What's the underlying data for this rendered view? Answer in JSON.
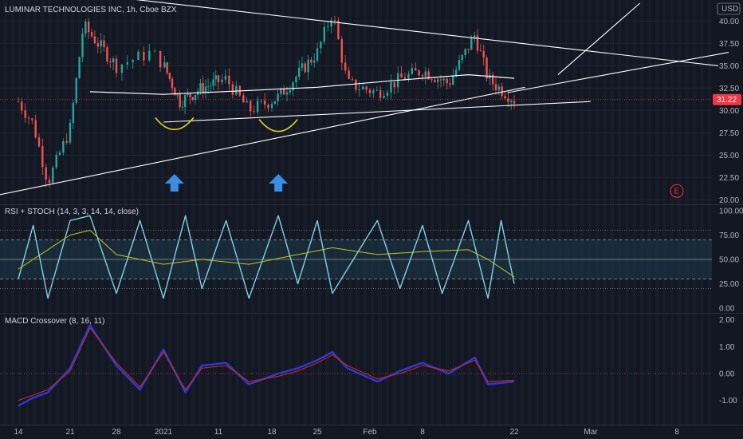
{
  "header": {
    "symbol_title": "LUMINAR TECHNOLOGIES INC, 1h, Cboe BZX",
    "currency": "USD"
  },
  "colors": {
    "background": "#131722",
    "candle_up": "#26a69a",
    "candle_down": "#ef5350",
    "trend_lines": "#ffffff",
    "rsi_line": "#7fd3e6",
    "stoch_line": "#c8c41e",
    "macd_line": "#2b3bd8",
    "signal_line": "#d0271f",
    "arrow": "#3a8ee6",
    "smile": "#e6d22a",
    "price_badge": "#f23645",
    "earnings_marker": "#f23645"
  },
  "chart_data": [
    {
      "type": "candlestick",
      "title": "LUMINAR TECHNOLOGIES INC, 1h, Cboe BZX",
      "ylim": [
        19.5,
        42
      ],
      "y_ticks": [
        "40.00",
        "37.50",
        "35.00",
        "32.50",
        "30.00",
        "27.50",
        "25.00",
        "22.50",
        "20.00"
      ],
      "last_price": "31.22",
      "approx_close_path": [
        {
          "x": "Dec 14",
          "y": 31.0
        },
        {
          "x": "Dec 16",
          "y": 28.5
        },
        {
          "x": "Dec 18",
          "y": 22.0
        },
        {
          "x": "Dec 21",
          "y": 28.0
        },
        {
          "x": "Dec 23",
          "y": 39.5
        },
        {
          "x": "Dec 28",
          "y": 35.0
        },
        {
          "x": "Dec 31",
          "y": 36.5
        },
        {
          "x": "Jan 4",
          "y": 31.0
        },
        {
          "x": "Jan 8",
          "y": 32.5
        },
        {
          "x": "Jan 12",
          "y": 33.5
        },
        {
          "x": "Jan 15",
          "y": 30.0
        },
        {
          "x": "Jan 19",
          "y": 31.5
        },
        {
          "x": "Jan 25",
          "y": 36.5
        },
        {
          "x": "Jan 27",
          "y": 41.0
        },
        {
          "x": "Jan 29",
          "y": 33.0
        },
        {
          "x": "Feb 2",
          "y": 32.0
        },
        {
          "x": "Feb 5",
          "y": 33.5
        },
        {
          "x": "Feb 8",
          "y": 34.5
        },
        {
          "x": "Feb 12",
          "y": 33.0
        },
        {
          "x": "Feb 16",
          "y": 38.5
        },
        {
          "x": "Feb 18",
          "y": 33.5
        },
        {
          "x": "Feb 22",
          "y": 31.2
        }
      ],
      "annotations": {
        "moving_average": [
          {
            "x": "Dec 24",
            "y": 32.1
          },
          {
            "x": "Jan 1",
            "y": 31.8
          },
          {
            "x": "Jan 14",
            "y": 32.2
          },
          {
            "x": "Jan 25",
            "y": 32.6
          },
          {
            "x": "Feb 5",
            "y": 33.4
          },
          {
            "x": "Feb 15",
            "y": 34.0
          },
          {
            "x": "Feb 22",
            "y": 33.6
          }
        ],
        "trend_lines": [
          {
            "from": {
              "x": "Dec 11",
              "y": 20.5
            },
            "to": {
              "x": "Feb 23",
              "y": 32.6
            }
          },
          {
            "from": {
              "x": "Jan 1",
              "y": 28.7
            },
            "to": {
              "x": "Mar 1",
              "y": 31.0
            }
          },
          {
            "from": {
              "x": "Dec 29",
              "y": 42.5
            },
            "to": {
              "x": "Mar 12",
              "y": 35.0
            }
          },
          {
            "from": {
              "x": "Feb 21",
              "y": 32.0
            },
            "to": {
              "x": "Mar 13",
              "y": 36.5
            }
          },
          {
            "from": {
              "x": "Feb 26",
              "y": 34.0
            },
            "to": {
              "x": "Mar 5",
              "y": 42.0
            }
          }
        ],
        "earnings_marker": {
          "x": "Mar 8",
          "y": 21.0,
          "label": "E"
        },
        "up_arrows": [
          "Jan 3",
          "Jan 19"
        ]
      }
    },
    {
      "type": "line",
      "title": "RSI + STOCH (14, 3, 3, 14, 14, close)",
      "ylim": [
        -5,
        105
      ],
      "y_ticks": [
        "100.00",
        "75.00",
        "50.00",
        "25.00",
        "0.00"
      ],
      "bands": {
        "upper": 70,
        "middle": 50,
        "lower": 30,
        "outer_upper": 80,
        "outer_lower": 20
      },
      "series": [
        {
          "name": "",
          "approx_values": [
            {
              "x": "Dec 14",
              "y": 30
            },
            {
              "x": "Dec 16",
              "y": 85
            },
            {
              "x": "Dec 18",
              "y": 10
            },
            {
              "x": "Dec 21",
              "y": 90
            },
            {
              "x": "Dec 24",
              "y": 95
            },
            {
              "x": "Dec 28",
              "y": 15
            },
            {
              "x": "Dec 30",
              "y": 90
            },
            {
              "x": "Jan 1",
              "y": 10
            },
            {
              "x": "Jan 5",
              "y": 95
            },
            {
              "x": "Jan 8",
              "y": 20
            },
            {
              "x": "Jan 12",
              "y": 90
            },
            {
              "x": "Jan 15",
              "y": 10
            },
            {
              "x": "Jan 19",
              "y": 95
            },
            {
              "x": "Jan 22",
              "y": 25
            },
            {
              "x": "Jan 25",
              "y": 90
            },
            {
              "x": "Jan 27",
              "y": 15
            },
            {
              "x": "Feb 2",
              "y": 90
            },
            {
              "x": "Feb 5",
              "y": 20
            },
            {
              "x": "Feb 8",
              "y": 85
            },
            {
              "x": "Feb 11",
              "y": 15
            },
            {
              "x": "Feb 15",
              "y": 90
            },
            {
              "x": "Feb 18",
              "y": 10
            },
            {
              "x": "Feb 20",
              "y": 90
            },
            {
              "x": "Feb 22",
              "y": 25
            }
          ]
        },
        {
          "name": "",
          "approx_values": [
            {
              "x": "Dec 14",
              "y": 40
            },
            {
              "x": "Dec 18",
              "y": 60
            },
            {
              "x": "Dec 21",
              "y": 75
            },
            {
              "x": "Dec 24",
              "y": 80
            },
            {
              "x": "Dec 28",
              "y": 55
            },
            {
              "x": "Jan 1",
              "y": 45
            },
            {
              "x": "Jan 8",
              "y": 50
            },
            {
              "x": "Jan 15",
              "y": 45
            },
            {
              "x": "Jan 22",
              "y": 55
            },
            {
              "x": "Jan 27",
              "y": 62
            },
            {
              "x": "Feb 2",
              "y": 55
            },
            {
              "x": "Feb 8",
              "y": 58
            },
            {
              "x": "Feb 15",
              "y": 60
            },
            {
              "x": "Feb 18",
              "y": 50
            },
            {
              "x": "Feb 22",
              "y": 32
            }
          ]
        }
      ]
    },
    {
      "type": "line",
      "title": "MACD Crossover (8, 16, 11)",
      "ylim": [
        -1.9,
        2.2
      ],
      "y_ticks": [
        "2.00",
        "1.00",
        "0.00",
        "-1.00"
      ],
      "series": [
        {
          "name": "",
          "approx_values": [
            {
              "x": "Dec 14",
              "y": -1.2
            },
            {
              "x": "Dec 16",
              "y": -0.9
            },
            {
              "x": "Dec 18",
              "y": -0.7
            },
            {
              "x": "Dec 21",
              "y": 0.2
            },
            {
              "x": "Dec 24",
              "y": 1.8
            },
            {
              "x": "Dec 28",
              "y": 0.3
            },
            {
              "x": "Dec 30",
              "y": -0.6
            },
            {
              "x": "Jan 1",
              "y": 0.9
            },
            {
              "x": "Jan 5",
              "y": -0.7
            },
            {
              "x": "Jan 8",
              "y": 0.3
            },
            {
              "x": "Jan 12",
              "y": 0.4
            },
            {
              "x": "Jan 15",
              "y": -0.4
            },
            {
              "x": "Jan 19",
              "y": 0.0
            },
            {
              "x": "Jan 22",
              "y": 0.2
            },
            {
              "x": "Jan 25",
              "y": 0.5
            },
            {
              "x": "Jan 27",
              "y": 0.8
            },
            {
              "x": "Jan 29",
              "y": 0.2
            },
            {
              "x": "Feb 2",
              "y": -0.3
            },
            {
              "x": "Feb 5",
              "y": 0.1
            },
            {
              "x": "Feb 8",
              "y": 0.4
            },
            {
              "x": "Feb 12",
              "y": 0.0
            },
            {
              "x": "Feb 16",
              "y": 0.6
            },
            {
              "x": "Feb 18",
              "y": -0.4
            },
            {
              "x": "Feb 22",
              "y": -0.3
            }
          ]
        },
        {
          "name": "",
          "approx_values": [
            {
              "x": "Dec 14",
              "y": -1.0
            },
            {
              "x": "Dec 16",
              "y": -0.8
            },
            {
              "x": "Dec 18",
              "y": -0.6
            },
            {
              "x": "Dec 21",
              "y": 0.1
            },
            {
              "x": "Dec 24",
              "y": 1.7
            },
            {
              "x": "Dec 28",
              "y": 0.4
            },
            {
              "x": "Dec 30",
              "y": -0.5
            },
            {
              "x": "Jan 1",
              "y": 0.8
            },
            {
              "x": "Jan 5",
              "y": -0.6
            },
            {
              "x": "Jan 8",
              "y": 0.2
            },
            {
              "x": "Jan 12",
              "y": 0.3
            },
            {
              "x": "Jan 15",
              "y": -0.3
            },
            {
              "x": "Jan 19",
              "y": -0.1
            },
            {
              "x": "Jan 22",
              "y": 0.1
            },
            {
              "x": "Jan 25",
              "y": 0.4
            },
            {
              "x": "Jan 27",
              "y": 0.7
            },
            {
              "x": "Jan 29",
              "y": 0.3
            },
            {
              "x": "Feb 2",
              "y": -0.2
            },
            {
              "x": "Feb 5",
              "y": 0.0
            },
            {
              "x": "Feb 8",
              "y": 0.3
            },
            {
              "x": "Feb 12",
              "y": 0.1
            },
            {
              "x": "Feb 16",
              "y": 0.5
            },
            {
              "x": "Feb 18",
              "y": -0.3
            },
            {
              "x": "Feb 22",
              "y": -0.25
            }
          ]
        }
      ]
    }
  ],
  "x_axis": {
    "tick_labels": [
      "14",
      "21",
      "28",
      "2021",
      "11",
      "18",
      "25",
      "Feb",
      "8",
      "22",
      "Mar",
      "8"
    ]
  }
}
